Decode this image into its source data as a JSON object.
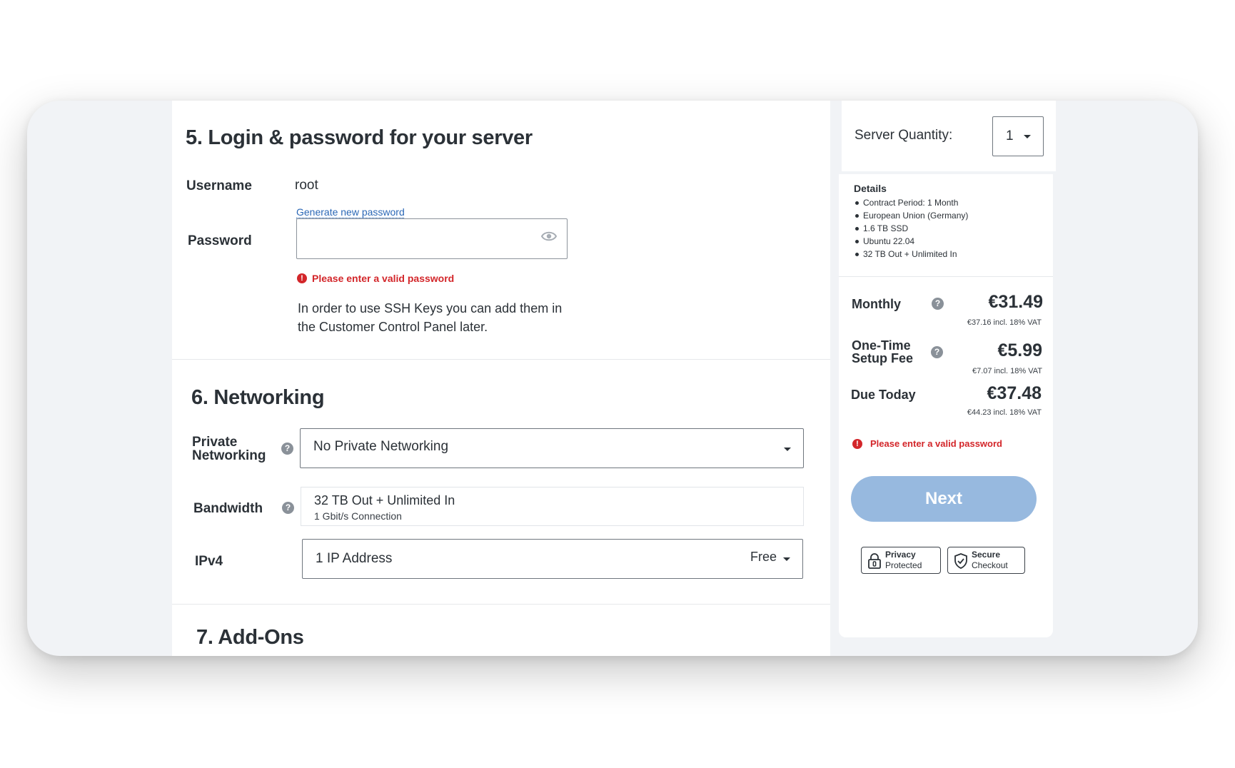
{
  "login": {
    "title": "5. Login & password for your server",
    "username_label": "Username",
    "username_value": "root",
    "generate_link": "Generate new password",
    "password_label": "Password",
    "password_value": "",
    "password_placeholder": "",
    "error": "Please enter a valid password",
    "ssh_note": "In order to use SSH Keys you can add them in the Customer Control Panel later."
  },
  "networking": {
    "title": "6. Networking",
    "private_label": "Private Networking",
    "private_value": "No Private Networking",
    "bandwidth_label": "Bandwidth",
    "bandwidth_value": "32 TB Out + Unlimited In",
    "bandwidth_sub": "1 Gbit/s Connection",
    "ipv4_label": "IPv4",
    "ipv4_value": "1 IP Address",
    "ipv4_price": "Free"
  },
  "addons": {
    "title": "7. Add-Ons"
  },
  "sidebar": {
    "quantity_label": "Server Quantity:",
    "quantity_value": "1",
    "details_title": "Details",
    "details": [
      "Contract Period: 1 Month",
      "European Union (Germany)",
      "1.6 TB SSD",
      "Ubuntu 22.04",
      "32 TB Out + Unlimited In"
    ],
    "monthly_label": "Monthly",
    "monthly_price": "€31.49",
    "monthly_vat": "€37.16 incl. 18% VAT",
    "setup_label_1": "One-Time",
    "setup_label_2": "Setup Fee",
    "setup_price": "€5.99",
    "setup_vat": "€7.07 incl. 18% VAT",
    "due_label": "Due Today",
    "due_price": "€37.48",
    "due_vat": "€44.23 incl. 18% VAT",
    "error": "Please enter a valid password",
    "next_label": "Next",
    "badge_privacy_1": "Privacy",
    "badge_privacy_2": "Protected",
    "badge_secure_1": "Secure",
    "badge_secure_2": "Checkout"
  },
  "icons": {
    "help": "?",
    "error": "!"
  },
  "colors": {
    "accent": "#2a67b6",
    "error": "#d3262a",
    "button_disabled": "#97b9df"
  }
}
